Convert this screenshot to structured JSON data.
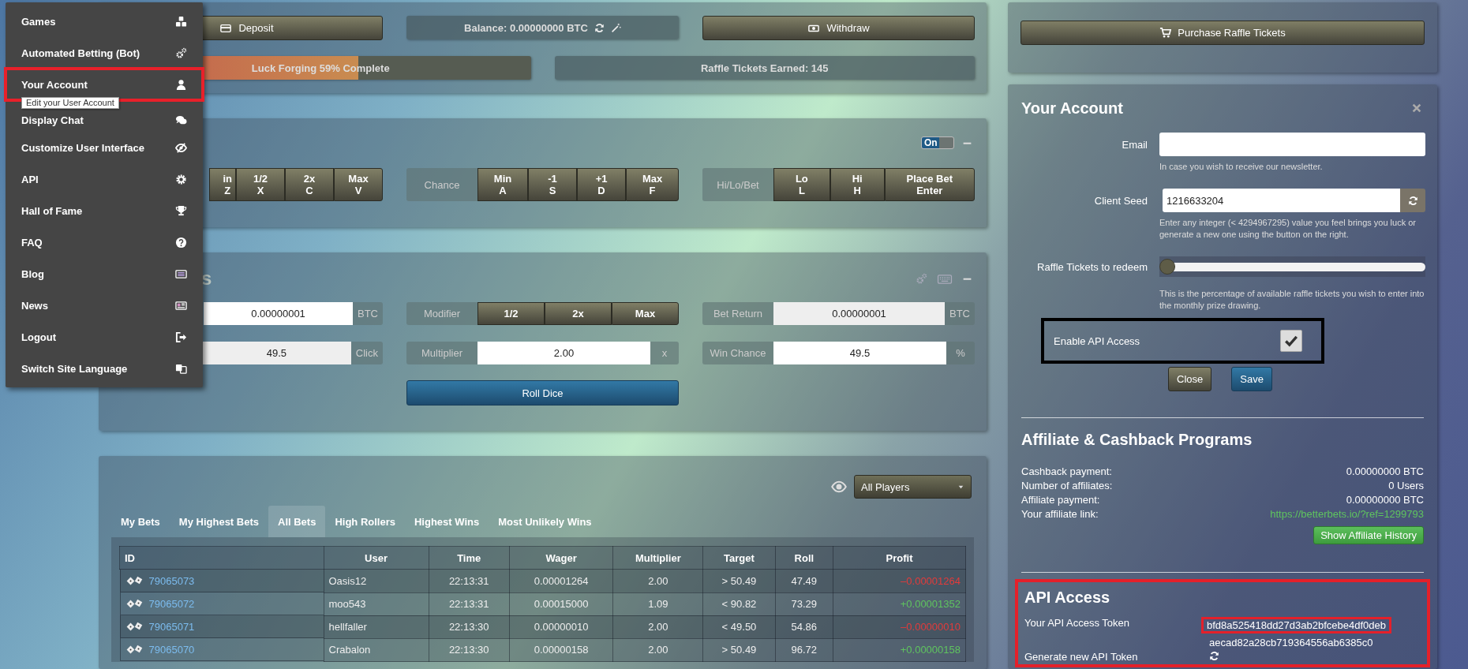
{
  "side_menu": {
    "items": [
      {
        "label": "Games",
        "highlighted": false
      },
      {
        "label": "Automated Betting (Bot)",
        "highlighted": false
      },
      {
        "label": "Your Account",
        "highlighted": true
      },
      {
        "label": "Display Chat",
        "highlighted": false
      },
      {
        "label": "Customize User Interface",
        "highlighted": false
      },
      {
        "label": "API",
        "highlighted": false
      },
      {
        "label": "Hall of Fame",
        "highlighted": false
      },
      {
        "label": "FAQ",
        "highlighted": false
      },
      {
        "label": "Blog",
        "highlighted": false
      },
      {
        "label": "News",
        "highlighted": false
      },
      {
        "label": "Logout",
        "highlighted": false
      },
      {
        "label": "Switch Site Language",
        "highlighted": false
      }
    ],
    "tooltip": "Edit your User Account"
  },
  "top_panel": {
    "deposit_button": "Deposit",
    "balance": "Balance: 0.00000000 BTC",
    "withdraw_button": "Withdraw",
    "luck_forging": {
      "label": "Luck Forging 59% Complete",
      "level": 0.59
    },
    "raffle_tickets_earned": "Raffle Tickets Earned: 145"
  },
  "hotkeys_panel": {
    "toggle": {
      "label": "On",
      "on": true
    },
    "groups": [
      {
        "buttons": [
          {
            "line_1": "in",
            "line_2": "Z",
            "cut_off": true
          },
          {
            "line_1": "1/2",
            "line_2": "X",
            "cut_off": false
          },
          {
            "line_1": "2x",
            "line_2": "C",
            "cut_off": false
          },
          {
            "line_1": "Max",
            "line_2": "V",
            "cut_off": false
          }
        ]
      },
      {
        "label": "Chance",
        "buttons": [
          {
            "line_1": "Min",
            "line_2": "A",
            "cut_off": false
          },
          {
            "line_1": "-1",
            "line_2": "S",
            "cut_off": false
          },
          {
            "line_1": "+1",
            "line_2": "D",
            "cut_off": false
          },
          {
            "line_1": "Max",
            "line_2": "F",
            "cut_off": false
          }
        ]
      },
      {
        "label": "Hi/Lo/Bet",
        "buttons": [
          {
            "line_1": "Lo",
            "line_2": "L",
            "cut_off": false
          },
          {
            "line_1": "Hi",
            "line_2": "H",
            "cut_off": false
          },
          {
            "line_1": "Place Bet",
            "line_2": "Enter",
            "cut_off": false
          }
        ]
      }
    ]
  },
  "bet_panel": {
    "title": "s",
    "rows": [
      [
        {
          "kind": "input",
          "value": "0.00000001",
          "addon": "BTC",
          "readonly": false
        },
        {
          "kind": "buttons",
          "label": "Modifier",
          "buttons": [
            "1/2",
            "2x",
            "Max"
          ]
        },
        {
          "kind": "input",
          "label": "Bet Return",
          "value": "0.00000001",
          "addon": "BTC",
          "readonly": true
        }
      ],
      [
        {
          "kind": "input",
          "value": "49.5",
          "addon": "Click",
          "readonly": true
        },
        {
          "kind": "input",
          "label": "Multiplier",
          "value": "2.00",
          "addon": "x",
          "readonly": false
        },
        {
          "kind": "input",
          "label": "Win Chance",
          "value": "49.5",
          "addon": "%",
          "readonly": false
        }
      ]
    ],
    "roll_button": "Roll Dice"
  },
  "bets_panel": {
    "filter": {
      "value": "All Players"
    },
    "tabs": [
      {
        "label": "My Bets",
        "selected": false
      },
      {
        "label": "My Highest Bets",
        "selected": false
      },
      {
        "label": "All Bets",
        "selected": true
      },
      {
        "label": "High Rollers",
        "selected": false
      },
      {
        "label": "Highest Wins",
        "selected": false
      },
      {
        "label": "Most Unlikely Wins",
        "selected": false
      }
    ],
    "table": {
      "columns": [
        "ID",
        "User",
        "Time",
        "Wager",
        "Multiplier",
        "Target",
        "Roll",
        "Profit"
      ],
      "rows": [
        {
          "id": "79065073",
          "user": "Oasis12",
          "time": "22:13:31",
          "wager": "0.00001264",
          "multiplier": "2.00",
          "target": "> 50.49",
          "roll": "47.49",
          "profit": "–0.00001264",
          "color": "#e33b3b"
        },
        {
          "id": "79065072",
          "user": "moo543",
          "time": "22:13:31",
          "wager": "0.00015000",
          "multiplier": "1.09",
          "target": "< 90.82",
          "roll": "73.29",
          "profit": "+0.00001352",
          "color": "#5fc45f"
        },
        {
          "id": "79065071",
          "user": "hellfaller",
          "time": "22:13:30",
          "wager": "0.00000010",
          "multiplier": "2.00",
          "target": "< 49.50",
          "roll": "54.86",
          "profit": "–0.00000010",
          "color": "#e33b3b"
        },
        {
          "id": "79065070",
          "user": "Crabalon",
          "time": "22:13:30",
          "wager": "0.00000158",
          "multiplier": "2.00",
          "target": "> 50.49",
          "roll": "96.72",
          "profit": "+0.00000158",
          "color": "#5fc45f"
        }
      ]
    }
  },
  "raffle_panel": {
    "purchase_button": "Purchase Raffle Tickets"
  },
  "account_panel": {
    "title": "Your Account",
    "email": {
      "label": "Email",
      "help": "In case you wish to receive our newsletter."
    },
    "client_seed": {
      "label": "Client Seed",
      "value": "1216633204",
      "help": "Enter any integer (< 4294967295) value you feel brings you luck or generate a new one using the button on the right."
    },
    "raffle_redeem": {
      "label": "Raffle Tickets to redeem",
      "level": 0,
      "help": "This is the percentage of available raffle tickets you wish to enter into the monthly prize drawing."
    },
    "enable_api": {
      "label": "Enable API Access",
      "checked": true,
      "outlined": true
    },
    "close_button": "Close",
    "save_button": "Save",
    "affiliate": {
      "title": "Affiliate & Cashback Programs",
      "rows": [
        {
          "kind": "value",
          "label": "Cashback payment:",
          "value": "0.00000000 BTC"
        },
        {
          "kind": "value",
          "label": "Number of affiliates:",
          "value": "0 Users"
        },
        {
          "kind": "value",
          "label": "Affiliate payment:",
          "value": "0.00000000 BTC"
        },
        {
          "kind": "link",
          "label": "Your affiliate link:",
          "value": "https://betterbets.io/?ref=1299793"
        }
      ],
      "history_button": "Show Affiliate History"
    },
    "api_access": {
      "title": "API Access",
      "highlighted": true,
      "token_label": "Your API Access Token",
      "token_lines": [
        {
          "text": "bfd8a525418dd27d3ab2bfcebe4df0deb",
          "outlined": true
        },
        {
          "text": "aecad82a28cb719364556ab6385c0",
          "outlined": false
        }
      ],
      "generate_label": "Generate new API Token"
    }
  }
}
